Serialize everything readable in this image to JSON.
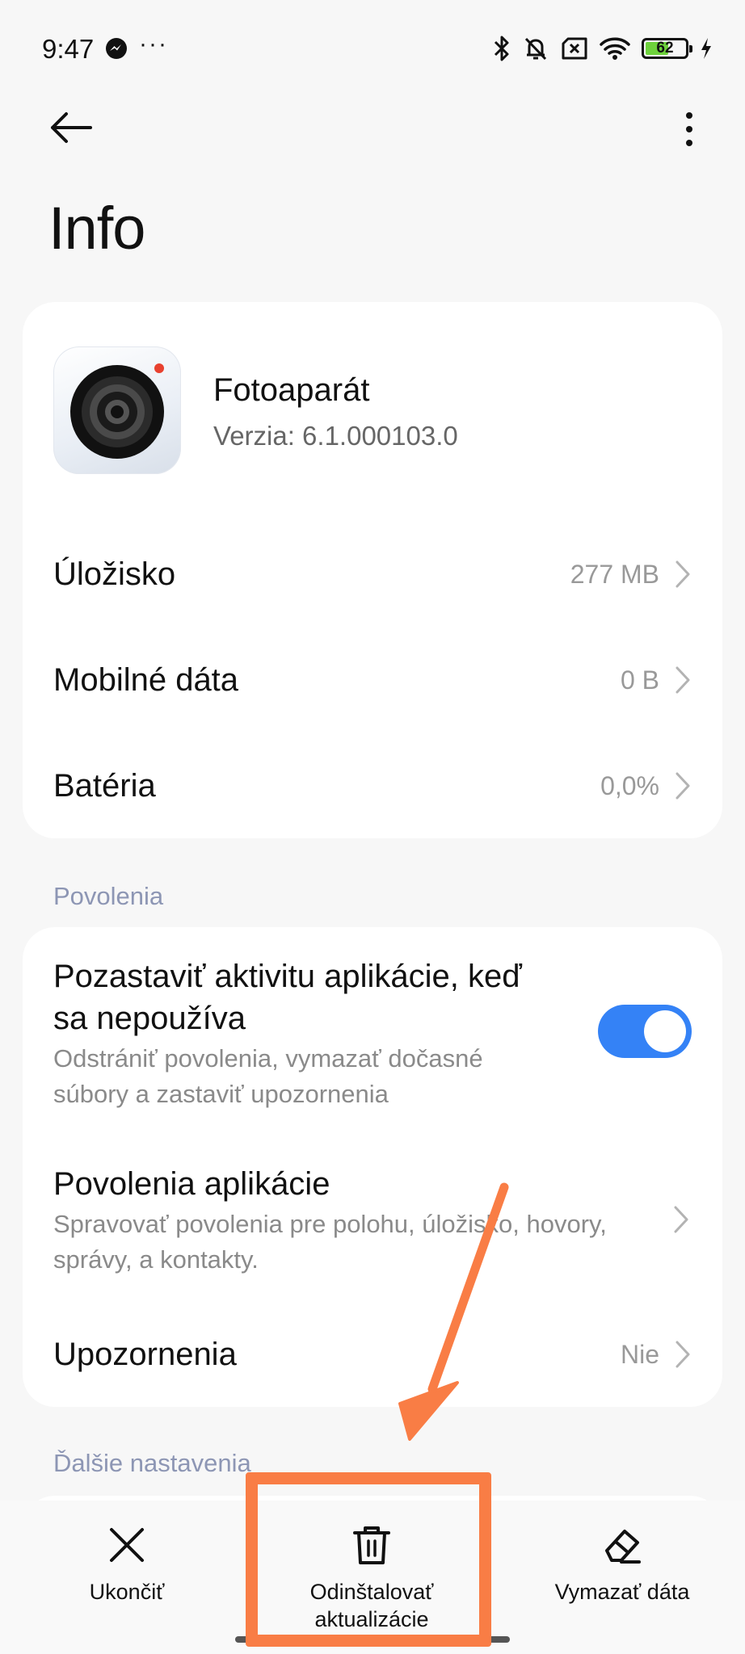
{
  "status_bar": {
    "time": "9:47",
    "more": "···",
    "battery": "62",
    "battery_level": 0.62,
    "icons": [
      "messenger-icon",
      "bluetooth-icon",
      "muted-bell-icon",
      "no-sim-icon",
      "wifi-icon",
      "battery-icon",
      "charging-icon"
    ]
  },
  "toolbar": {
    "back_icon": "arrow-left-icon",
    "menu_icon": "more-vertical-icon"
  },
  "page": {
    "title": "Info"
  },
  "app": {
    "name": "Fotoaparát",
    "version": "Verzia: 6.1.000103.0",
    "icon": "camera-app-icon"
  },
  "usage": [
    {
      "label": "Úložisko",
      "value": "277 MB"
    },
    {
      "label": "Mobilné dáta",
      "value": "0 B"
    },
    {
      "label": "Batéria",
      "value": "0,0%"
    }
  ],
  "permissions": {
    "section_label": "Povolenia",
    "pause": {
      "title": "Pozastaviť aktivitu aplikácie, keď sa nepoužíva",
      "subtitle": "Odstrániť povolenia, vymazať dočasné súbory a zastaviť upozornenia",
      "enabled": true
    },
    "app_permissions": {
      "title": "Povolenia aplikácie",
      "subtitle": "Spravovať povolenia pre polohu, úložisko, hovory, správy, a kontakty."
    },
    "notifications": {
      "label": "Upozornenia",
      "value": "Nie"
    }
  },
  "more_settings": {
    "section_label": "Ďalšie nastavenia"
  },
  "actions": {
    "close": "Ukončiť",
    "uninstall_line1": "Odinštalovať",
    "uninstall_line2": "aktualizácie",
    "clear": "Vymazať dáta"
  },
  "colors": {
    "accent": "#3482f6",
    "annotation": "#f97d45",
    "section": "#8d96b4"
  }
}
